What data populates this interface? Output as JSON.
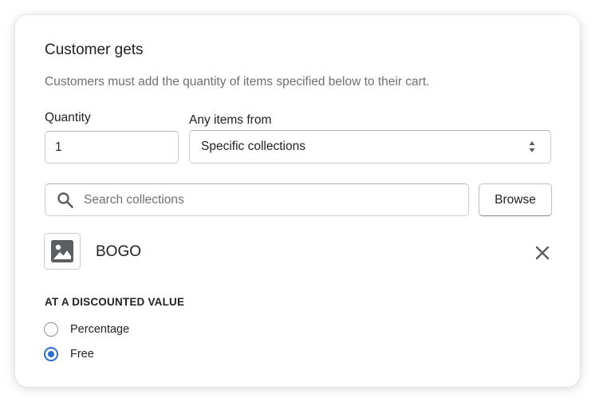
{
  "card": {
    "title": "Customer gets",
    "help_text": "Customers must add the quantity of items specified below to their cart."
  },
  "quantity": {
    "label": "Quantity",
    "value": "1"
  },
  "any_items_from": {
    "label": "Any items from",
    "selected": "Specific collections"
  },
  "search": {
    "placeholder": "Search collections",
    "browse_label": "Browse"
  },
  "collection": {
    "name": "BOGO",
    "icon": "image-icon"
  },
  "discount": {
    "heading": "AT A DISCOUNTED VALUE",
    "options": [
      {
        "label": "Percentage",
        "checked": false
      },
      {
        "label": "Free",
        "checked": true
      }
    ],
    "accent_color": "#2c6ecb"
  }
}
